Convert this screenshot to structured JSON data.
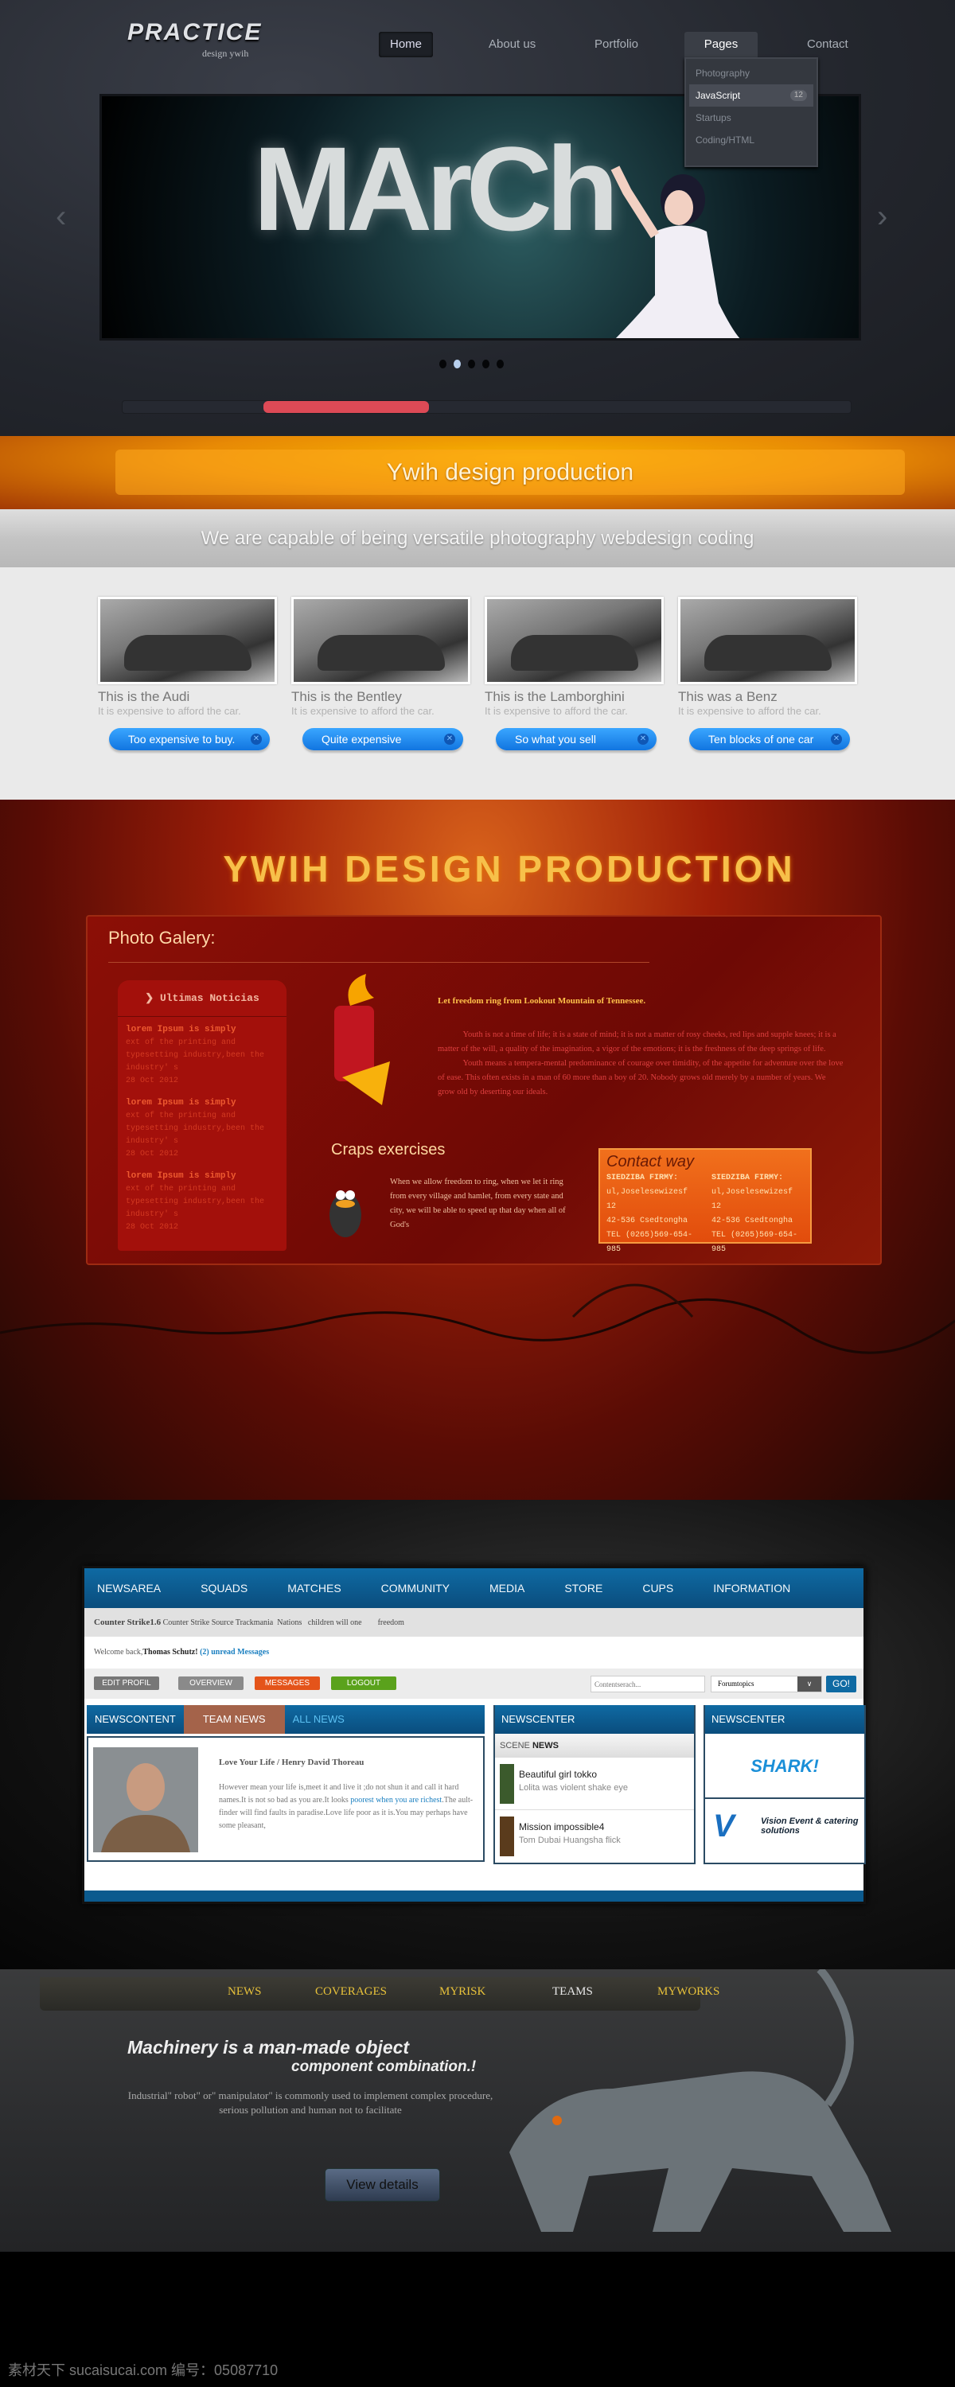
{
  "header": {
    "logo": "PRACTICE",
    "logo_sub": "design ywih",
    "nav": [
      "Home",
      "About us",
      "Portfolio",
      "Pages",
      "Contact"
    ],
    "active_nav": "Home",
    "open_nav": "Pages",
    "dropdown": [
      {
        "label": "Photography"
      },
      {
        "label": "JavaScript",
        "badge": "12"
      },
      {
        "label": "Startups"
      },
      {
        "label": "Coding/HTML"
      }
    ]
  },
  "slider": {
    "headline": "MArCh",
    "active_dot": 2,
    "dot_count": 5,
    "scroll_position": 0.25
  },
  "banner": {
    "orange_text": "Ywih design  production",
    "gray_text": "We are capable of  being  versatile  photography  webdesign coding"
  },
  "cars": [
    {
      "title": "This is the Audi",
      "subtitle": "It is expensive to afford the car.",
      "button": "Too expensive to buy."
    },
    {
      "title": "This is the Bentley",
      "subtitle": "It is expensive to afford the car.",
      "button": "Quite expensive"
    },
    {
      "title": "This is the Lamborghini",
      "subtitle": "It is expensive to afford the car.",
      "button": "So what you sell"
    },
    {
      "title": "This was a Benz",
      "subtitle": "It is expensive to afford the car.",
      "button": "Ten blocks of one car"
    }
  ],
  "red": {
    "title": "YWIH DESIGN PRODUCTION",
    "gallery_title": "Photo Galery:",
    "news_header": "Ultimas Noticias",
    "news_items": [
      {
        "title": "lorem Ipsum is simply",
        "text": "ext of the printing and typesetting industry,been the industry' s",
        "date": "28 Oct 2012"
      },
      {
        "title": "lorem Ipsum is simply",
        "text": "ext of the printing and typesetting industry,been the industry' s",
        "date": "28 Oct 2012"
      },
      {
        "title": "lorem Ipsum is simply",
        "text": "ext of the printing and typesetting industry,been the industry' s",
        "date": "28 Oct 2012"
      }
    ],
    "lead": "Let freedom ring from Lookout Mountain of Tennessee.",
    "body_p1": "Youth is not a time of life; it is a state of mind; it is not a matter of rosy cheeks, red lips and supple knees; it is a matter of the will, a quality of the imagination, a vigor of the emotions; it is the freshness of the deep springs of life.",
    "body_p2": "Youth means a tempera-mental predominance of courage over timidity, of the appetite for adventure over the love of ease. This often exists in a man of 60 more than a boy of 20. Nobody grows old merely by a number of years. We grow old by deserting our ideals.",
    "craps_title": "Craps exercises",
    "craps_text": "When we allow freedom to ring, when we let it ring from every village and hamlet, from every state and city, we will be able to speed up that day when all of God's",
    "contact_title": "Contact way",
    "contact_cols": [
      [
        "SIEDZIBA FIRMY:",
        "ul,Joselesewizesf 12",
        "42-536 Csedtongha",
        "TEL (0265)569-654-985"
      ],
      [
        "SIEDZIBA FIRMY:",
        "ul,Joselesewizesf 12",
        "42-536 Csedtongha",
        "TEL (0265)569-654-985"
      ]
    ]
  },
  "forum": {
    "nav": [
      "NEWSAREA",
      "SQUADS",
      "MATCHES",
      "COMMUNITY",
      "MEDIA",
      "STORE",
      "CUPS",
      "INFORMATION"
    ],
    "subnav_main": "Counter Strike1.6",
    "subnav_rest": "Counter Strike Source Trackmania  Nations   children will one        freedom",
    "welcome": "Welcome back,",
    "user": "Thomas Schutz!",
    "unread": "(2) unread Messages",
    "buttons": [
      "EDIT PROFIL",
      "OVERVIEW",
      "MESSAGES",
      "LOGOUT"
    ],
    "search_placeholder": "Contentserach...",
    "select_value": "Forumtopics",
    "go": "GO!",
    "tabs": [
      "NEWSCONTENT",
      "TEAM NEWS",
      "ALL NEWS"
    ],
    "article_title": "Love Your Life / Henry David Thoreau",
    "article_pre": "However mean your life is,meet it and live it ;do not shun it and call it hard names.It is not so bad as you are.It looks ",
    "article_link": "poorest when you are richest",
    "article_post": ".The ault-finder will find faults in paradise.Love life poor as it is.You may perhaps have some pleasant,",
    "newscenter_title": "NEWSCENTER",
    "scene_news_a": "SCENE ",
    "scene_news_b": "NEWS",
    "scene_items": [
      {
        "title": "Beautiful girl tokko",
        "sub": "Lolita was violent shake eye"
      },
      {
        "title": "Mission impossible4",
        "sub": "Tom Dubai Huangsha flick"
      }
    ],
    "sponsor_title": "NEWSCENTER",
    "sponsors": [
      "SHARK!",
      "Vision Event & catering solutions"
    ]
  },
  "bottom": {
    "nav": [
      "NEWS",
      "COVERAGES",
      "MYRISK",
      "TEAMS",
      "MYWORKS"
    ],
    "active_nav": "TEAMS",
    "headline1": "Machinery is a man-made object",
    "headline2": "component combination.!",
    "body": "Industrial\" robot\" or\" manipulator\" is commonly used to implement complex procedure, serious pollution and human not to facilitate",
    "button": "View details"
  },
  "watermark": "素材天下 sucaisucai.com  编号：05087710",
  "colors": {
    "accent_red": "#dd4a56",
    "forum_blue": "#0a4d7d",
    "button_blue": "#1a85f0",
    "gold": "#e7c13a"
  }
}
